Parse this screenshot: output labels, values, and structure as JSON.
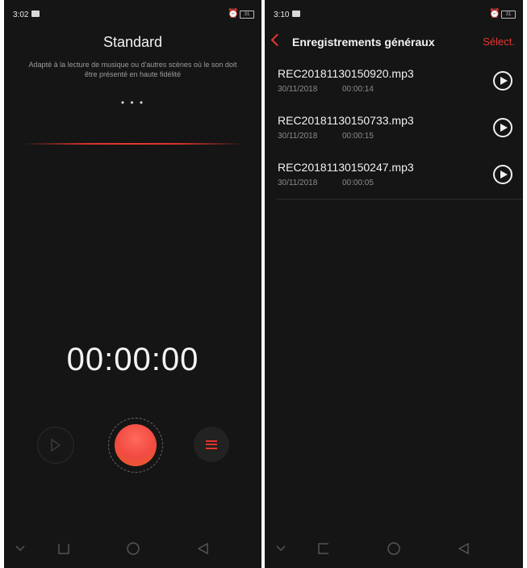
{
  "left_screen": {
    "status_time": "3:02",
    "battery": "31",
    "mode_title": "Standard",
    "mode_description": "Adapté à la lecture de musique ou d'autres scènes où le son doit être présenté en haute fidélité",
    "pager_dots": "• • •",
    "timer": "00:00:00"
  },
  "right_screen": {
    "status_time": "3:10",
    "battery": "31",
    "header_title": "Enregistrements généraux",
    "select_label": "Sélect.",
    "recordings": [
      {
        "name": "REC20181130150920.mp3",
        "date": "30/11/2018",
        "duration": "00:00:14"
      },
      {
        "name": "REC20181130150733.mp3",
        "date": "30/11/2018",
        "duration": "00:00:15"
      },
      {
        "name": "REC20181130150247.mp3",
        "date": "30/11/2018",
        "duration": "00:00:05"
      }
    ]
  },
  "colors": {
    "accent": "#e8372f",
    "background": "#151515"
  },
  "icons": [
    "alarm-icon",
    "battery-icon",
    "play-icon",
    "record-icon",
    "list-icon",
    "back-icon",
    "nav-down-icon",
    "nav-home-icon",
    "nav-recent-icon",
    "nav-back-icon"
  ]
}
